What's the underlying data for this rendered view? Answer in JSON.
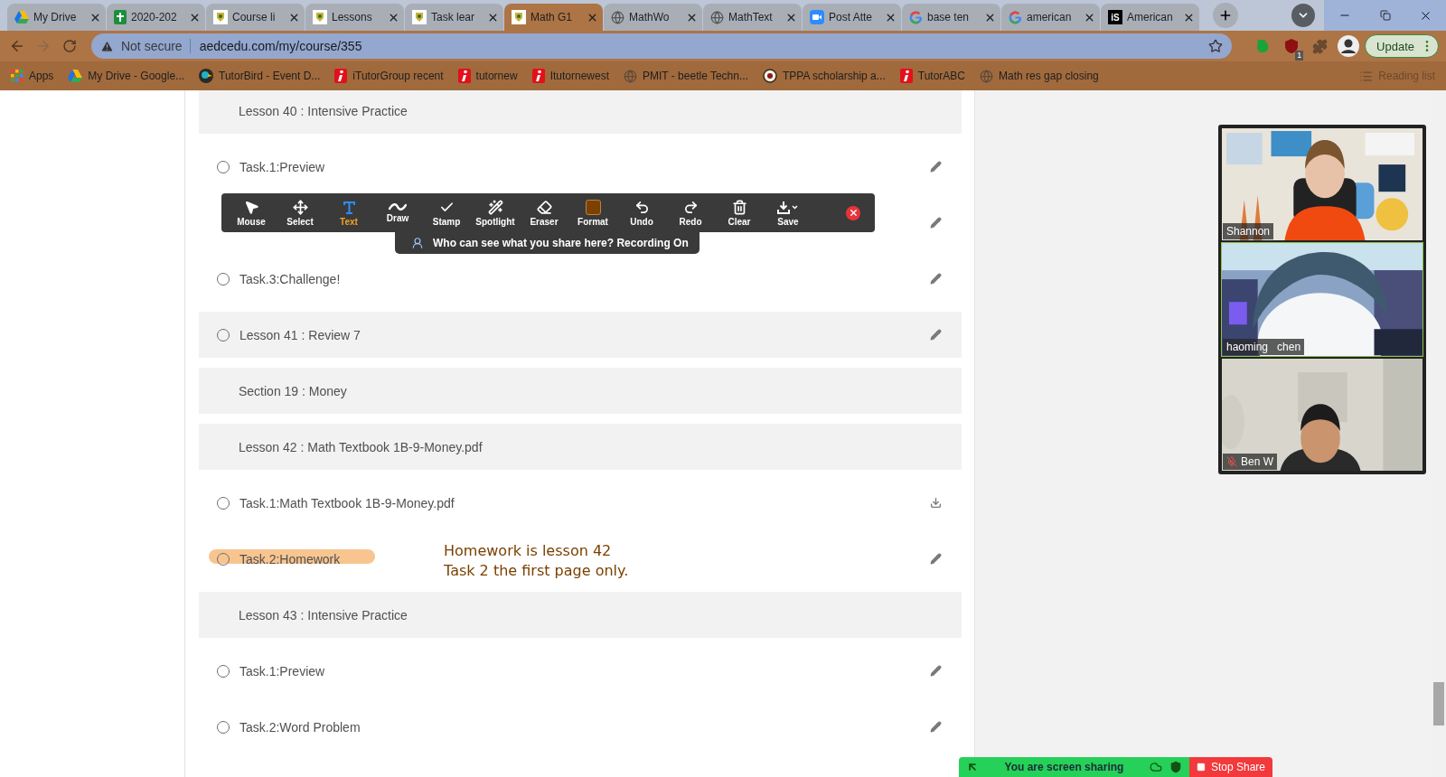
{
  "browser": {
    "tabs": [
      {
        "title": "My Drive",
        "kind": "drive",
        "selected": false
      },
      {
        "title": "2020-202",
        "kind": "sheets",
        "selected": false
      },
      {
        "title": "Course li",
        "kind": "school",
        "selected": false
      },
      {
        "title": "Lessons",
        "kind": "school",
        "selected": false
      },
      {
        "title": "Task lear",
        "kind": "school",
        "selected": false
      },
      {
        "title": "Math G1",
        "kind": "school",
        "selected": true
      },
      {
        "title": "MathWo",
        "kind": "globe",
        "selected": false
      },
      {
        "title": "MathText",
        "kind": "globe",
        "selected": false
      },
      {
        "title": "Post Atte",
        "kind": "video",
        "selected": false
      },
      {
        "title": "base ten",
        "kind": "google",
        "selected": false
      },
      {
        "title": "american",
        "kind": "google",
        "selected": false
      },
      {
        "title": "American",
        "kind": "letters",
        "logo_text": "iS",
        "selected": false
      }
    ],
    "address": {
      "security": "Not secure",
      "url": "aedcedu.com/my/course/355"
    },
    "extension_badge": "1",
    "update_button": "Update",
    "bookmarks": [
      {
        "label": "Apps",
        "kind": "grid"
      },
      {
        "label": "My Drive - Google...",
        "kind": "drive"
      },
      {
        "label": "TutorBird - Event D...",
        "kind": "bird"
      },
      {
        "label": "iTutorGroup recent",
        "kind": "brand"
      },
      {
        "label": "tutornew",
        "kind": "brand"
      },
      {
        "label": "Itutornewest",
        "kind": "brand"
      },
      {
        "label": "PMIT - beetle Techn...",
        "kind": "globe"
      },
      {
        "label": "TPPA scholarship a...",
        "kind": "seal"
      },
      {
        "label": "TutorABC",
        "kind": "brand"
      },
      {
        "label": "Math res gap closing",
        "kind": "globe"
      }
    ],
    "reading_list": "Reading list"
  },
  "course": {
    "rows": [
      {
        "kind": "group",
        "label": "Lesson 40 : Intensive Practice",
        "highlighted": false
      },
      {
        "kind": "item",
        "label": "Task.1:Preview",
        "checked": false,
        "highlighted": false
      },
      {
        "kind": "item",
        "highlighted": false
      },
      {
        "kind": "item",
        "label": "Task.3:Challenge!",
        "checked": false,
        "highlighted": false
      },
      {
        "kind": "shaded-item",
        "label": "Lesson 41 : Review 7",
        "checked": false,
        "highlighted": false
      },
      {
        "kind": "group",
        "label": "Section 19 : Money",
        "highlighted": false
      },
      {
        "kind": "group",
        "label": "Lesson 42 : Math Textbook 1B-9-Money.pdf",
        "highlighted": false
      },
      {
        "kind": "file",
        "label": "Task.1:Math Textbook 1B-9-Money.pdf",
        "checked": false,
        "highlighted": false
      },
      {
        "kind": "item",
        "label": "Task.2:Homework",
        "checked": false,
        "highlighted": true,
        "note": [
          "Homework is lesson 42",
          "Task 2 the first page only."
        ]
      },
      {
        "kind": "group",
        "label": "Lesson 43 : Intensive Practice",
        "highlighted": false
      },
      {
        "kind": "item",
        "label": "Task.1:Preview",
        "checked": false,
        "highlighted": false
      },
      {
        "kind": "item",
        "label": "Task.2:Word Problem",
        "checked": false,
        "highlighted": false
      }
    ]
  },
  "annotate_toolbar": {
    "tools": [
      {
        "label": "Mouse",
        "kind": "mouse",
        "selected": false
      },
      {
        "label": "Select",
        "kind": "select",
        "selected": false
      },
      {
        "label": "Text",
        "kind": "text",
        "selected": true
      },
      {
        "label": "Draw",
        "kind": "draw",
        "selected": false
      },
      {
        "label": "Stamp",
        "kind": "stamp",
        "selected": false
      },
      {
        "label": "Spotlight",
        "kind": "spotlight",
        "selected": false
      },
      {
        "label": "Eraser",
        "kind": "eraser",
        "selected": false
      },
      {
        "label": "Format",
        "kind": "format",
        "selected": false
      },
      {
        "label": "Undo",
        "kind": "undo",
        "selected": false
      },
      {
        "label": "Redo",
        "kind": "redo",
        "selected": false
      },
      {
        "label": "Clear",
        "kind": "clear",
        "selected": false
      },
      {
        "label": "Save",
        "kind": "save",
        "selected": false
      }
    ],
    "notice": "Who can see what you share here? Recording On"
  },
  "video_panel": {
    "participants": [
      {
        "name": "Shannon",
        "muted": false,
        "active": false
      },
      {
        "name": "haoming   chen",
        "muted": false,
        "active": true
      },
      {
        "name": "Ben W",
        "muted": true,
        "active": false
      }
    ]
  },
  "share_bar": {
    "status": "You are screen sharing",
    "stop_button": "Stop Share"
  }
}
